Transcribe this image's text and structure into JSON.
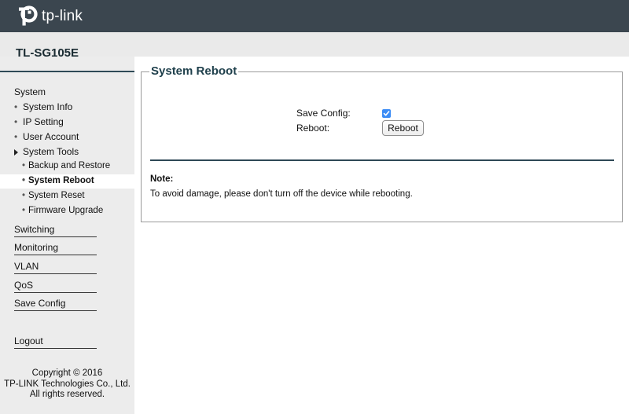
{
  "header": {
    "brand": "tp-link",
    "logo_icon": "tp-link-logo-icon",
    "background_color": "#3b464f"
  },
  "model": {
    "name": "TL-SG105E"
  },
  "sidebar": {
    "system_label": "System",
    "system_items": [
      {
        "label": "System Info"
      },
      {
        "label": "IP Setting"
      },
      {
        "label": "User Account"
      }
    ],
    "system_tools": {
      "label": "System Tools",
      "expanded": true,
      "items": [
        {
          "label": "Backup and Restore",
          "active": false
        },
        {
          "label": "System Reboot",
          "active": true
        },
        {
          "label": "System Reset",
          "active": false
        },
        {
          "label": "Firmware Upgrade",
          "active": false
        }
      ]
    },
    "sections": [
      {
        "label": "Switching"
      },
      {
        "label": "Monitoring"
      },
      {
        "label": "VLAN"
      },
      {
        "label": "QoS"
      },
      {
        "label": "Save Config"
      }
    ],
    "logout_label": "Logout",
    "copyright": {
      "line1": "Copyright © 2016",
      "line2": "TP-LINK Technologies Co., Ltd.",
      "line3": "All rights reserved."
    }
  },
  "main": {
    "title": "System Reboot",
    "save_config_label": "Save Config:",
    "save_config_checked": true,
    "reboot_label": "Reboot:",
    "reboot_button": "Reboot",
    "note_title": "Note:",
    "note_text": "To avoid damage, please don't turn off the device while rebooting."
  },
  "colors": {
    "accent": "#1e3f4b",
    "sidebar_bg": "#ececec",
    "checkbox": "#3b8cf5"
  }
}
